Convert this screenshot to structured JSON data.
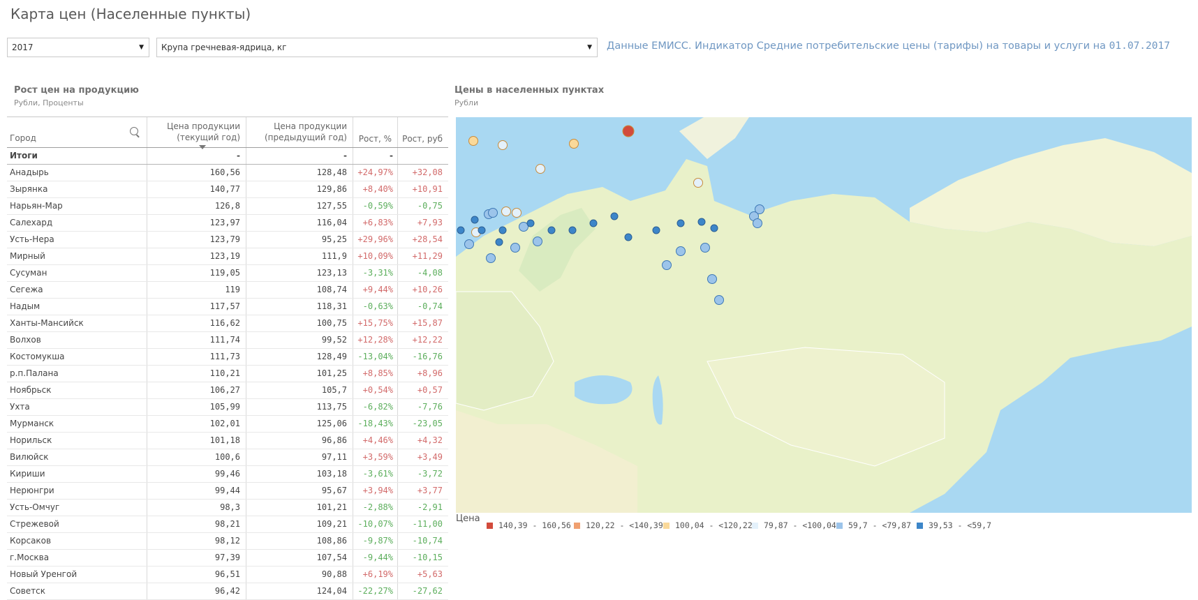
{
  "header": {
    "title": "Карта цен (Населенные пункты)",
    "year": "2017",
    "product": "Крупа гречневая-ядрица, кг",
    "info_prefix": "Данные ЕМИСС. Индикатор Средние потребительские цены (тарифы) на товары и услуги на",
    "info_date": "01.07.2017"
  },
  "table_panel": {
    "title": "Рост цен на продукцию",
    "subtitle": "Рубли, Проценты",
    "columns": {
      "city": "Город",
      "cur_line1": "Цена продукции",
      "cur_line2": "(текущий год)",
      "prev_line1": "Цена продукции",
      "prev_line2": "(предыдущий год)",
      "pct": "Рост, %",
      "rub": "Рост, руб"
    },
    "totals": {
      "label": "Итоги",
      "cur": "-",
      "prev": "-",
      "pct": "-",
      "rub": ""
    },
    "rows": [
      {
        "city": "Анадырь",
        "cur": "160,56",
        "prev": "128,48",
        "pct": "+24,97%",
        "rub": "+32,08"
      },
      {
        "city": "Зырянка",
        "cur": "140,77",
        "prev": "129,86",
        "pct": "+8,40%",
        "rub": "+10,91"
      },
      {
        "city": "Нарьян-Мар",
        "cur": "126,8",
        "prev": "127,55",
        "pct": "-0,59%",
        "rub": "-0,75"
      },
      {
        "city": "Салехард",
        "cur": "123,97",
        "prev": "116,04",
        "pct": "+6,83%",
        "rub": "+7,93"
      },
      {
        "city": "Усть-Нера",
        "cur": "123,79",
        "prev": "95,25",
        "pct": "+29,96%",
        "rub": "+28,54"
      },
      {
        "city": "Мирный",
        "cur": "123,19",
        "prev": "111,9",
        "pct": "+10,09%",
        "rub": "+11,29"
      },
      {
        "city": "Сусуман",
        "cur": "119,05",
        "prev": "123,13",
        "pct": "-3,31%",
        "rub": "-4,08"
      },
      {
        "city": "Сегежа",
        "cur": "119",
        "prev": "108,74",
        "pct": "+9,44%",
        "rub": "+10,26"
      },
      {
        "city": "Надым",
        "cur": "117,57",
        "prev": "118,31",
        "pct": "-0,63%",
        "rub": "-0,74"
      },
      {
        "city": "Ханты-Мансийск",
        "cur": "116,62",
        "prev": "100,75",
        "pct": "+15,75%",
        "rub": "+15,87"
      },
      {
        "city": "Волхов",
        "cur": "111,74",
        "prev": "99,52",
        "pct": "+12,28%",
        "rub": "+12,22"
      },
      {
        "city": "Костомукша",
        "cur": "111,73",
        "prev": "128,49",
        "pct": "-13,04%",
        "rub": "-16,76"
      },
      {
        "city": "р.п.Палана",
        "cur": "110,21",
        "prev": "101,25",
        "pct": "+8,85%",
        "rub": "+8,96"
      },
      {
        "city": "Ноябрьск",
        "cur": "106,27",
        "prev": "105,7",
        "pct": "+0,54%",
        "rub": "+0,57"
      },
      {
        "city": "Ухта",
        "cur": "105,99",
        "prev": "113,75",
        "pct": "-6,82%",
        "rub": "-7,76"
      },
      {
        "city": "Мурманск",
        "cur": "102,01",
        "prev": "125,06",
        "pct": "-18,43%",
        "rub": "-23,05"
      },
      {
        "city": "Норильск",
        "cur": "101,18",
        "prev": "96,86",
        "pct": "+4,46%",
        "rub": "+4,32"
      },
      {
        "city": "Вилюйск",
        "cur": "100,6",
        "prev": "97,11",
        "pct": "+3,59%",
        "rub": "+3,49"
      },
      {
        "city": "Кириши",
        "cur": "99,46",
        "prev": "103,18",
        "pct": "-3,61%",
        "rub": "-3,72"
      },
      {
        "city": "Нерюнгри",
        "cur": "99,44",
        "prev": "95,67",
        "pct": "+3,94%",
        "rub": "+3,77"
      },
      {
        "city": "Усть-Омчуг",
        "cur": "98,3",
        "prev": "101,21",
        "pct": "-2,88%",
        "rub": "-2,91"
      },
      {
        "city": "Стрежевой",
        "cur": "98,21",
        "prev": "109,21",
        "pct": "-10,07%",
        "rub": "-11,00"
      },
      {
        "city": "Корсаков",
        "cur": "98,12",
        "prev": "108,86",
        "pct": "-9,87%",
        "rub": "-10,74"
      },
      {
        "city": "г.Москва",
        "cur": "97,39",
        "prev": "107,54",
        "pct": "-9,44%",
        "rub": "-10,15"
      },
      {
        "city": "Новый Уренгой",
        "cur": "96,51",
        "prev": "90,88",
        "pct": "+6,19%",
        "rub": "+5,63"
      },
      {
        "city": "Советск",
        "cur": "96,42",
        "prev": "124,04",
        "pct": "-22,27%",
        "rub": "-27,62"
      }
    ]
  },
  "map_panel": {
    "title": "Цены в населенных пунктах",
    "subtitle": "Рубли",
    "legend_title": "Цена",
    "legend": [
      {
        "label": "140,39 - 160,56",
        "color": "#d24b3c"
      },
      {
        "label": "120,22 - <140,39",
        "color": "#f0a070"
      },
      {
        "label": "100,04 - <120,22",
        "color": "#fad99a"
      },
      {
        "label": "79,87 - <100,04",
        "color": "#e4f1fb"
      },
      {
        "label": "59,7 - <79,87",
        "color": "#9cc4ea"
      },
      {
        "label": "39,53 - <59,7",
        "color": "#3d86c9"
      }
    ]
  },
  "icons": {
    "search": "search-icon",
    "dropdown": "dropdown-arrow-icon",
    "sort": "sort-descending-icon"
  }
}
